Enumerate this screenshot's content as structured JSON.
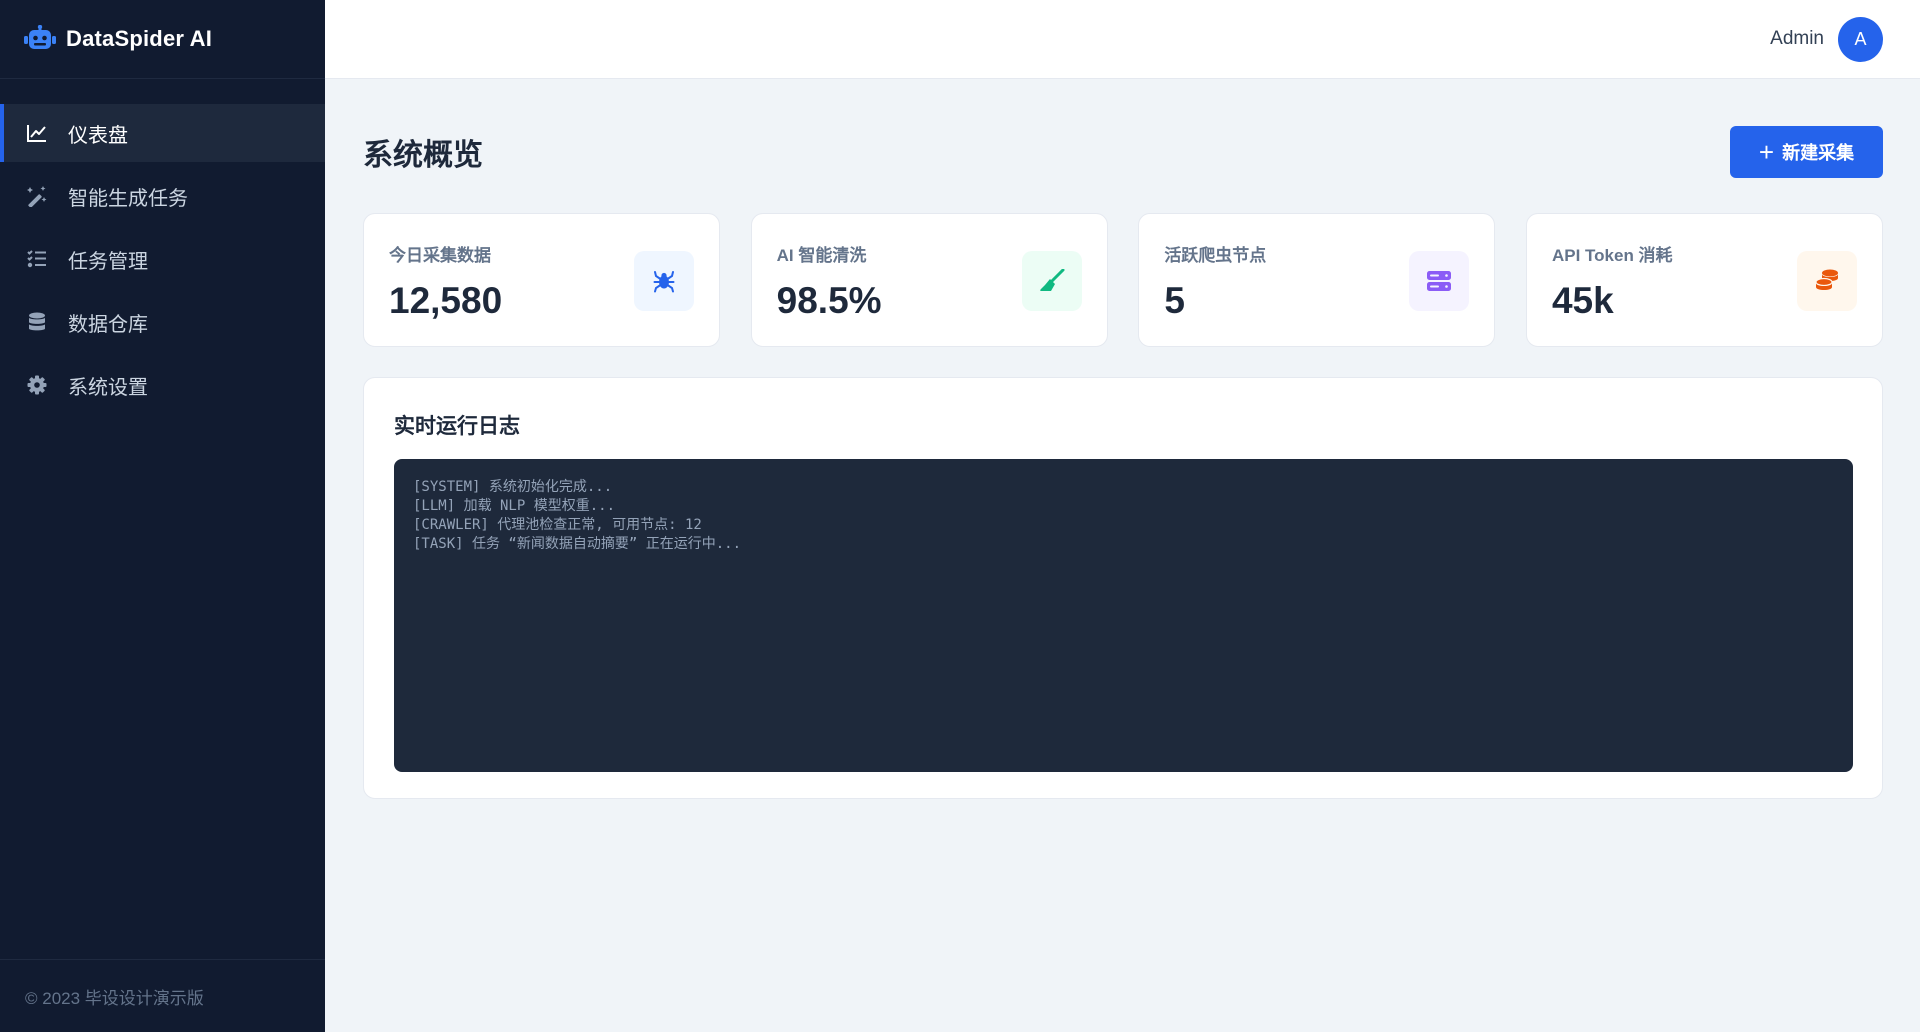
{
  "app": {
    "name": "DataSpider AI"
  },
  "sidebar": {
    "items": [
      {
        "label": "仪表盘",
        "icon": "chart-line-icon",
        "active": true
      },
      {
        "label": "智能生成任务",
        "icon": "magic-wand-icon",
        "active": false
      },
      {
        "label": "任务管理",
        "icon": "task-list-icon",
        "active": false
      },
      {
        "label": "数据仓库",
        "icon": "database-icon",
        "active": false
      },
      {
        "label": "系统设置",
        "icon": "gear-icon",
        "active": false
      }
    ],
    "footer": "© 2023 毕设设计演示版"
  },
  "topbar": {
    "user_name": "Admin",
    "avatar_letter": "A"
  },
  "page": {
    "title": "系统概览",
    "new_button_label": "新建采集"
  },
  "stats": [
    {
      "label": "今日采集数据",
      "value": "12,580",
      "icon": "spider-icon",
      "icon_color": "#2563eb",
      "icon_bg": "#eff6ff"
    },
    {
      "label": "AI 智能清洗",
      "value": "98.5%",
      "icon": "broom-icon",
      "icon_color": "#10b981",
      "icon_bg": "#ecfdf5"
    },
    {
      "label": "活跃爬虫节点",
      "value": "5",
      "icon": "server-icon",
      "icon_color": "#8b5cf6",
      "icon_bg": "#f5f3ff"
    },
    {
      "label": "API Token 消耗",
      "value": "45k",
      "icon": "coins-icon",
      "icon_color": "#ea580c",
      "icon_bg": "#fff7ed"
    }
  ],
  "log": {
    "title": "实时运行日志",
    "lines": [
      "[SYSTEM] 系统初始化完成...",
      "[LLM] 加载 NLP 模型权重...",
      "[CRAWLER] 代理池检查正常, 可用节点: 12",
      "[TASK] 任务 “新闻数据自动摘要” 正在运行中..."
    ]
  },
  "colors": {
    "sidebar_bg": "#111b30",
    "accent": "#2563eb",
    "page_bg": "#f0f4f8",
    "console_bg": "#1e293b"
  }
}
